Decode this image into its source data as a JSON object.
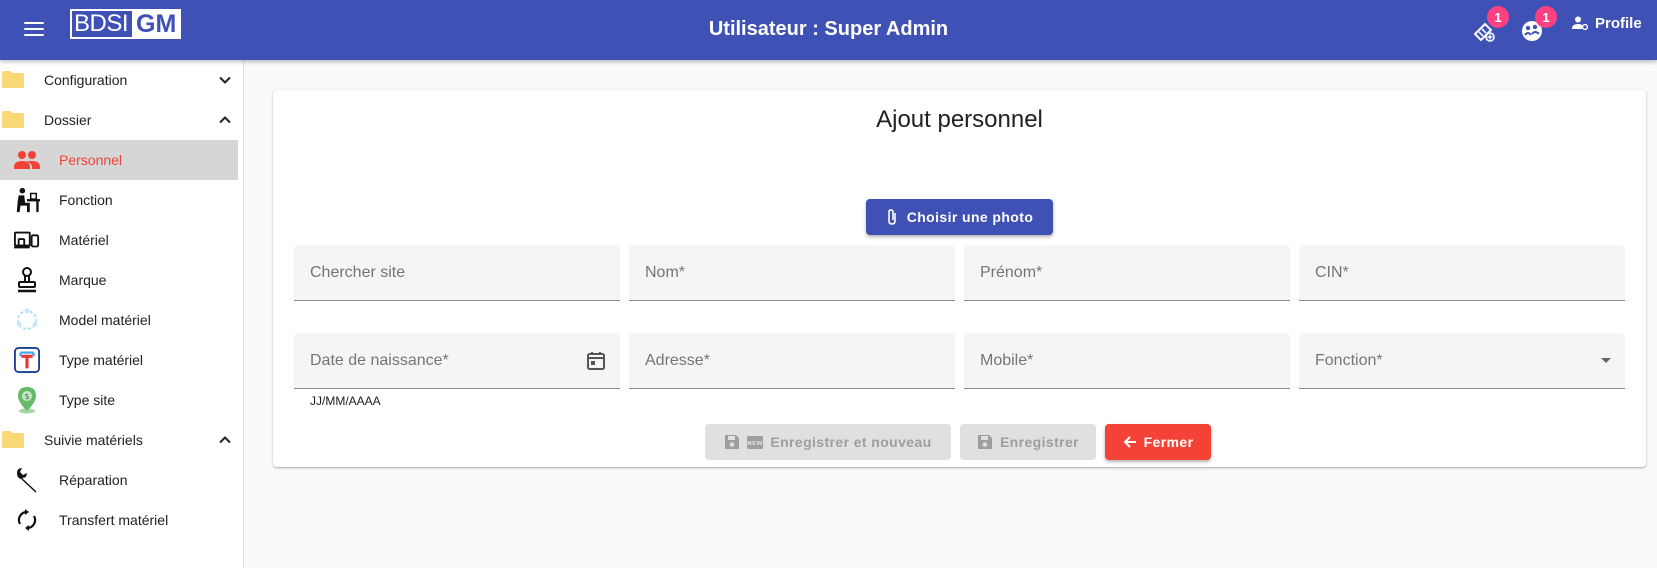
{
  "header": {
    "logo_part1": "BDSI",
    "logo_part2": "GM",
    "title": "Utilisateur : Super Admin",
    "notif1_count": "1",
    "notif2_count": "1",
    "profile_label": "Profile"
  },
  "sidebar": {
    "groups": [
      {
        "label": "Configuration",
        "expanded": false
      },
      {
        "label": "Dossier",
        "expanded": true
      },
      {
        "label": "Suivie matériels",
        "expanded": true
      }
    ],
    "items": [
      {
        "label": "Personnel",
        "icon": "people-icon",
        "active": true
      },
      {
        "label": "Fonction",
        "icon": "person-desk-icon",
        "active": false
      },
      {
        "label": "Matériel",
        "icon": "devices-icon",
        "active": false
      },
      {
        "label": "Marque",
        "icon": "stamp-icon",
        "active": false
      },
      {
        "label": "Model matériel",
        "icon": "model-icon",
        "active": false
      },
      {
        "label": "Type matériel",
        "icon": "type-t-icon",
        "active": false
      },
      {
        "label": "Type site",
        "icon": "map-pin-icon",
        "active": false
      },
      {
        "label": "Réparation",
        "icon": "wrench-icon",
        "active": false
      },
      {
        "label": "Transfert matériel",
        "icon": "sync-icon",
        "active": false
      }
    ]
  },
  "form": {
    "title": "Ajout personnel",
    "photo_button": "Choisir une photo",
    "fields": {
      "site": "Chercher site",
      "nom": "Nom*",
      "prenom": "Prénom*",
      "cin": "CIN*",
      "date": "Date de naissance*",
      "adresse": "Adresse*",
      "mobile": "Mobile*",
      "fonction": "Fonction*"
    },
    "date_hint": "JJ/MM/AAAA",
    "buttons": {
      "save_new": "Enregistrer et nouveau",
      "save": "Enregistrer",
      "close": "Fermer"
    }
  },
  "colors": {
    "primary": "#3f51b5",
    "warn": "#f44336",
    "badge": "#ff4081",
    "folder": "#f9d976"
  }
}
